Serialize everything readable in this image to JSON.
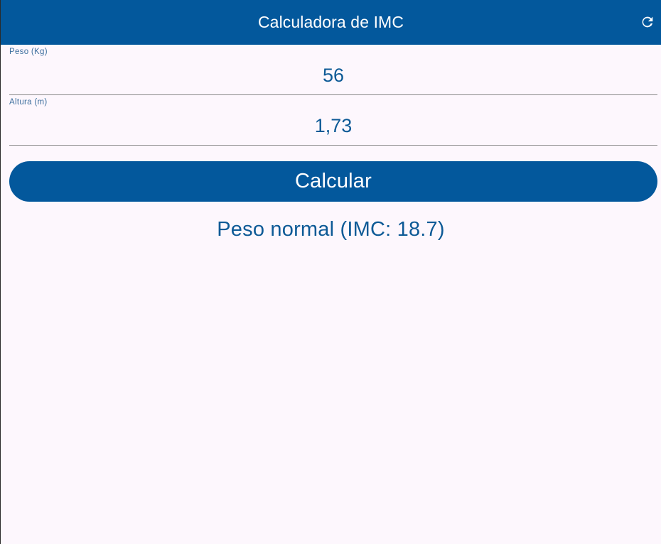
{
  "app_bar": {
    "title": "Calculadora de IMC",
    "refresh_icon": "refresh-icon"
  },
  "form": {
    "peso": {
      "label": "Peso (Kg)",
      "value": "56"
    },
    "altura": {
      "label": "Altura (m)",
      "value": "1,73"
    }
  },
  "actions": {
    "calculate_label": "Calcular"
  },
  "result": {
    "text": "Peso normal (IMC: 18.7)"
  },
  "colors": {
    "primary": "#03589c",
    "text_primary": "#0d5a96",
    "background": "#fdf7fd"
  }
}
